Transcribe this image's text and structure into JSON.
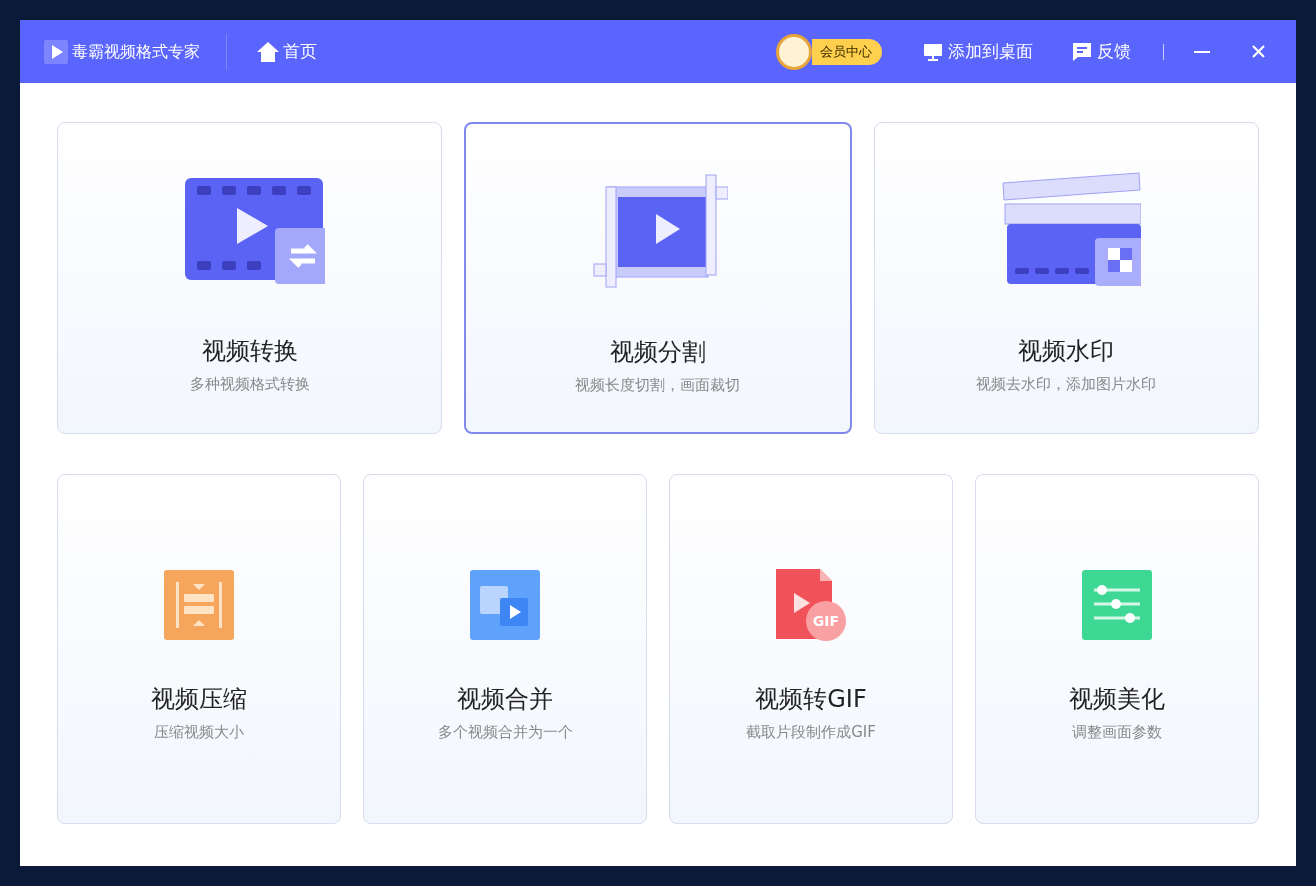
{
  "window": {
    "title": "毒霸视频格式专家"
  },
  "nav": {
    "home": "首页"
  },
  "toolbar": {
    "vip": "会员中心",
    "add_desktop": "添加到桌面",
    "feedback": "反馈"
  },
  "features_top": [
    {
      "kind": "convert",
      "title": "视频转换",
      "subtitle": "多种视频格式转换",
      "selected": false
    },
    {
      "kind": "split",
      "title": "视频分割",
      "subtitle": "视频长度切割，画面裁切",
      "selected": true
    },
    {
      "kind": "watermark",
      "title": "视频水印",
      "subtitle": "视频去水印，添加图片水印",
      "selected": false
    }
  ],
  "features_bottom": [
    {
      "kind": "compress",
      "title": "视频压缩",
      "subtitle": "压缩视频大小",
      "selected": false
    },
    {
      "kind": "merge",
      "title": "视频合并",
      "subtitle": "多个视频合并为一个",
      "selected": false
    },
    {
      "kind": "gif",
      "title": "视频转GIF",
      "subtitle": "截取片段制作成GIF",
      "badge": "GIF",
      "selected": false
    },
    {
      "kind": "beautify",
      "title": "视频美化",
      "subtitle": "调整画面参数",
      "selected": false
    }
  ]
}
